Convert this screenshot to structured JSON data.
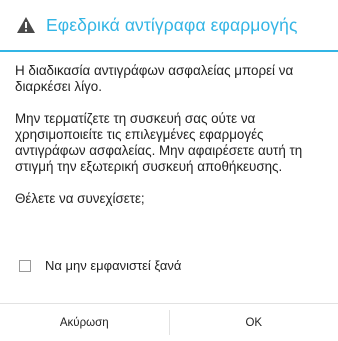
{
  "dialog": {
    "icon": "warning-icon",
    "title": "Εφεδρικά αντίγραφα εφαρμογής",
    "accent_color": "#33b5e5",
    "paragraph_1": "Η διαδικασία αντιγράφων ασφαλείας μπορεί να διαρκέσει λίγο.",
    "paragraph_2": "Μην τερματίζετε τη συσκευή σας ούτε να χρησιμοποιείτε τις επιλεγμένες εφαρμογές αντιγράφων ασφαλείας. Μην αφαιρέσετε αυτή τη στιγμή την εξωτερική συσκευή αποθήκευσης.",
    "paragraph_3": "Θέλετε να συνεχίσετε;",
    "checkbox": {
      "label": "Να μην εμφανιστεί ξανά",
      "checked": false
    },
    "buttons": {
      "cancel_label": "Ακύρωση",
      "ok_label": "OK"
    }
  }
}
